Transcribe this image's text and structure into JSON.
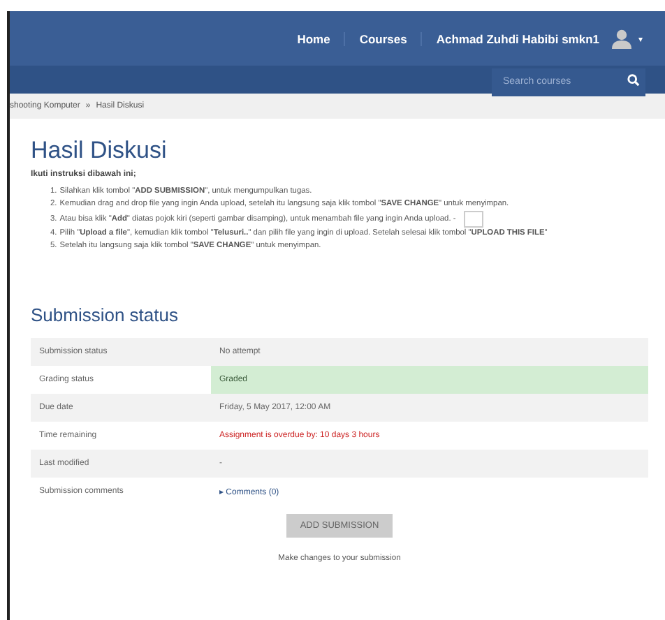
{
  "navbar": {
    "links": [
      "Home",
      "Courses"
    ],
    "user": "Achmad Zuhdi Habibi smkn1",
    "menu_caret": "▾"
  },
  "search": {
    "placeholder": "Search courses"
  },
  "breadcrumb": [
    "shooting Komputer",
    "Hasil Diskusi"
  ],
  "breadcrumb_separator": "»",
  "title": "Hasil Diskusi",
  "intro": "Ikuti instruksi dibawah ini;",
  "instructions": [
    {
      "number": "1.",
      "text": "Silahkan klik tombol \"**ADD SUBMISSION**\", untuk mengumpulkan tugas.",
      "has_icon": false
    },
    {
      "number": "2.",
      "text": "Kemudian drag and drop file yang ingin Anda upload, setelah itu langsung saja klik tombol \"**SAVE CHANGE**\" untuk menyimpan.",
      "has_icon": false
    },
    {
      "number": "3.",
      "text": "Atau bisa klik \"**Add**\" diatas pojok kiri (seperti gambar disamping), untuk menambah file yang ingin Anda upload. -",
      "has_icon": true
    },
    {
      "number": "4.",
      "text": "Pilih \"**Upload a file**\", kemudian klik tombol \"**Telusuri..**\" dan pilih file yang ingin di upload. Setelah selesai klik tombol \"**UPLOAD THIS FILE**\"",
      "has_icon": false
    },
    {
      "number": "5.",
      "text": "Setelah itu langsung saja klik tombol \"**SAVE CHANGE**\" untuk menyimpan.",
      "has_icon": false
    }
  ],
  "section_title": "Submission status",
  "status_rows": [
    {
      "label": "Submission status",
      "value": "No attempt",
      "kind": "plain"
    },
    {
      "label": "Grading status",
      "value": "Graded",
      "kind": "success"
    },
    {
      "label": "Due date",
      "value": "Friday, 5 May 2017, 12:00 AM",
      "kind": "plain"
    },
    {
      "label": "Time remaining",
      "value": "Assignment is overdue by: 10 days 3 hours",
      "kind": "danger"
    },
    {
      "label": "Last modified",
      "value": "-",
      "kind": "plain"
    },
    {
      "label": "Submission comments",
      "value": "▸ Comments (0)",
      "kind": "link"
    }
  ],
  "button": "ADD SUBMISSION",
  "button_hint": "Make changes to your submission"
}
